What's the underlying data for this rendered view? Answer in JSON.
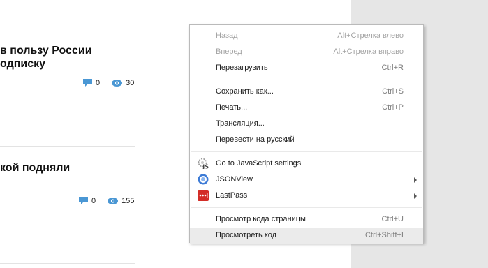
{
  "articles": [
    {
      "title_line1": "в пользу России",
      "title_line2": "одписку",
      "comments": "0",
      "views": "30"
    },
    {
      "title_line1": "кой подняли",
      "comments": "0",
      "views": "155"
    }
  ],
  "context_menu": {
    "back": {
      "label": "Назад",
      "shortcut": "Alt+Стрелка влево"
    },
    "forward": {
      "label": "Вперед",
      "shortcut": "Alt+Стрелка вправо"
    },
    "reload": {
      "label": "Перезагрузить",
      "shortcut": "Ctrl+R"
    },
    "save_as": {
      "label": "Сохранить как...",
      "shortcut": "Ctrl+S"
    },
    "print": {
      "label": "Печать...",
      "shortcut": "Ctrl+P"
    },
    "cast": {
      "label": "Трансляция..."
    },
    "translate": {
      "label": "Перевести на русский"
    },
    "js_settings": {
      "label": "Go to JavaScript settings",
      "icon": "js-settings-icon",
      "icon_text": "JS"
    },
    "jsonview": {
      "label": "JSONView",
      "icon": "jsonview-icon"
    },
    "lastpass": {
      "label": "LastPass",
      "icon": "lastpass-icon"
    },
    "view_source": {
      "label": "Просмотр кода страницы",
      "shortcut": "Ctrl+U"
    },
    "inspect": {
      "label": "Просмотреть код",
      "shortcut": "Ctrl+Shift+I"
    }
  },
  "colors": {
    "stat_icon": "#4a97d4",
    "lastpass_red": "#d32d27",
    "jsonview_blue": "#3d7bd6",
    "menu_highlight": "#ebebeb"
  }
}
